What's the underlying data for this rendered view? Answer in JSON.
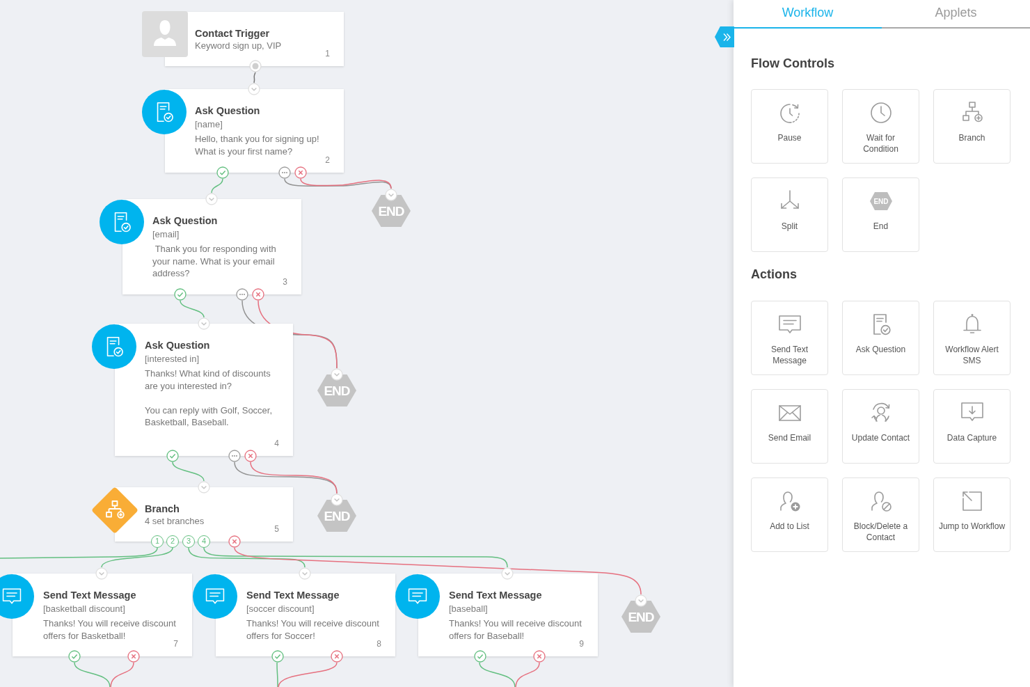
{
  "canvas": {
    "nodes": [
      {
        "kind": "trigger",
        "title": "Contact Trigger",
        "subtitle": "Keyword sign up, VIP",
        "number": "1"
      },
      {
        "kind": "question",
        "title": "Ask Question",
        "variable": "[name]",
        "message": "Hello, thank you for signing up! What is your first name?",
        "number": "2"
      },
      {
        "kind": "question",
        "title": "Ask Question",
        "variable": "[email]",
        "message": " Thank you for responding with your name. What is your email address?",
        "number": "3"
      },
      {
        "kind": "question",
        "title": "Ask Question",
        "variable": "[interested in]",
        "message": "Thanks! What kind of discounts are you interested in?\n\nYou can reply with Golf, Soccer, Basketball, Baseball.",
        "number": "4"
      },
      {
        "kind": "branch",
        "title": "Branch",
        "subtitle": "4 set branches",
        "number": "5",
        "outputs": [
          "1",
          "2",
          "3",
          "4"
        ]
      },
      {
        "kind": "message",
        "title": "Send Text Message",
        "variable": "[basketball discount]",
        "message": "Thanks! You will receive discount offers for Basketball!",
        "number": "7"
      },
      {
        "kind": "message",
        "title": "Send Text Message",
        "variable": "[soccer discount]",
        "message": "Thanks! You will receive discount offers for Soccer!",
        "number": "8"
      },
      {
        "kind": "message",
        "title": "Send Text Message",
        "variable": "[baseball]",
        "message": "Thanks! You will receive discount offers for Baseball!",
        "number": "9"
      }
    ],
    "end_markers": [
      {
        "label": "END"
      },
      {
        "label": "END"
      },
      {
        "label": "END"
      },
      {
        "label": "END"
      }
    ]
  },
  "panel": {
    "tabs": [
      {
        "label": "Workflow",
        "selected": true
      },
      {
        "label": "Applets",
        "selected": false
      }
    ],
    "sections": [
      {
        "title": "Flow Controls",
        "tiles": [
          {
            "kind": "pause",
            "label": "Pause"
          },
          {
            "kind": "wait",
            "label": "Wait for\nCondition"
          },
          {
            "kind": "branch",
            "label": "Branch"
          },
          {
            "kind": "split",
            "label": "Split"
          },
          {
            "kind": "end",
            "label": "End",
            "icon_text": "END"
          }
        ]
      },
      {
        "title": "Actions",
        "tiles": [
          {
            "kind": "sms",
            "label": "Send Text\nMessage"
          },
          {
            "kind": "question",
            "label": "Ask Question"
          },
          {
            "kind": "alert",
            "label": "Workflow Alert\nSMS"
          },
          {
            "kind": "email",
            "label": "Send Email"
          },
          {
            "kind": "update",
            "label": "Update Contact"
          },
          {
            "kind": "capture",
            "label": "Data Capture"
          },
          {
            "kind": "addlist",
            "label": "Add to List"
          },
          {
            "kind": "block",
            "label": "Block/Delete a\nContact"
          },
          {
            "kind": "jump",
            "label": "Jump to Workflow"
          }
        ]
      }
    ]
  }
}
